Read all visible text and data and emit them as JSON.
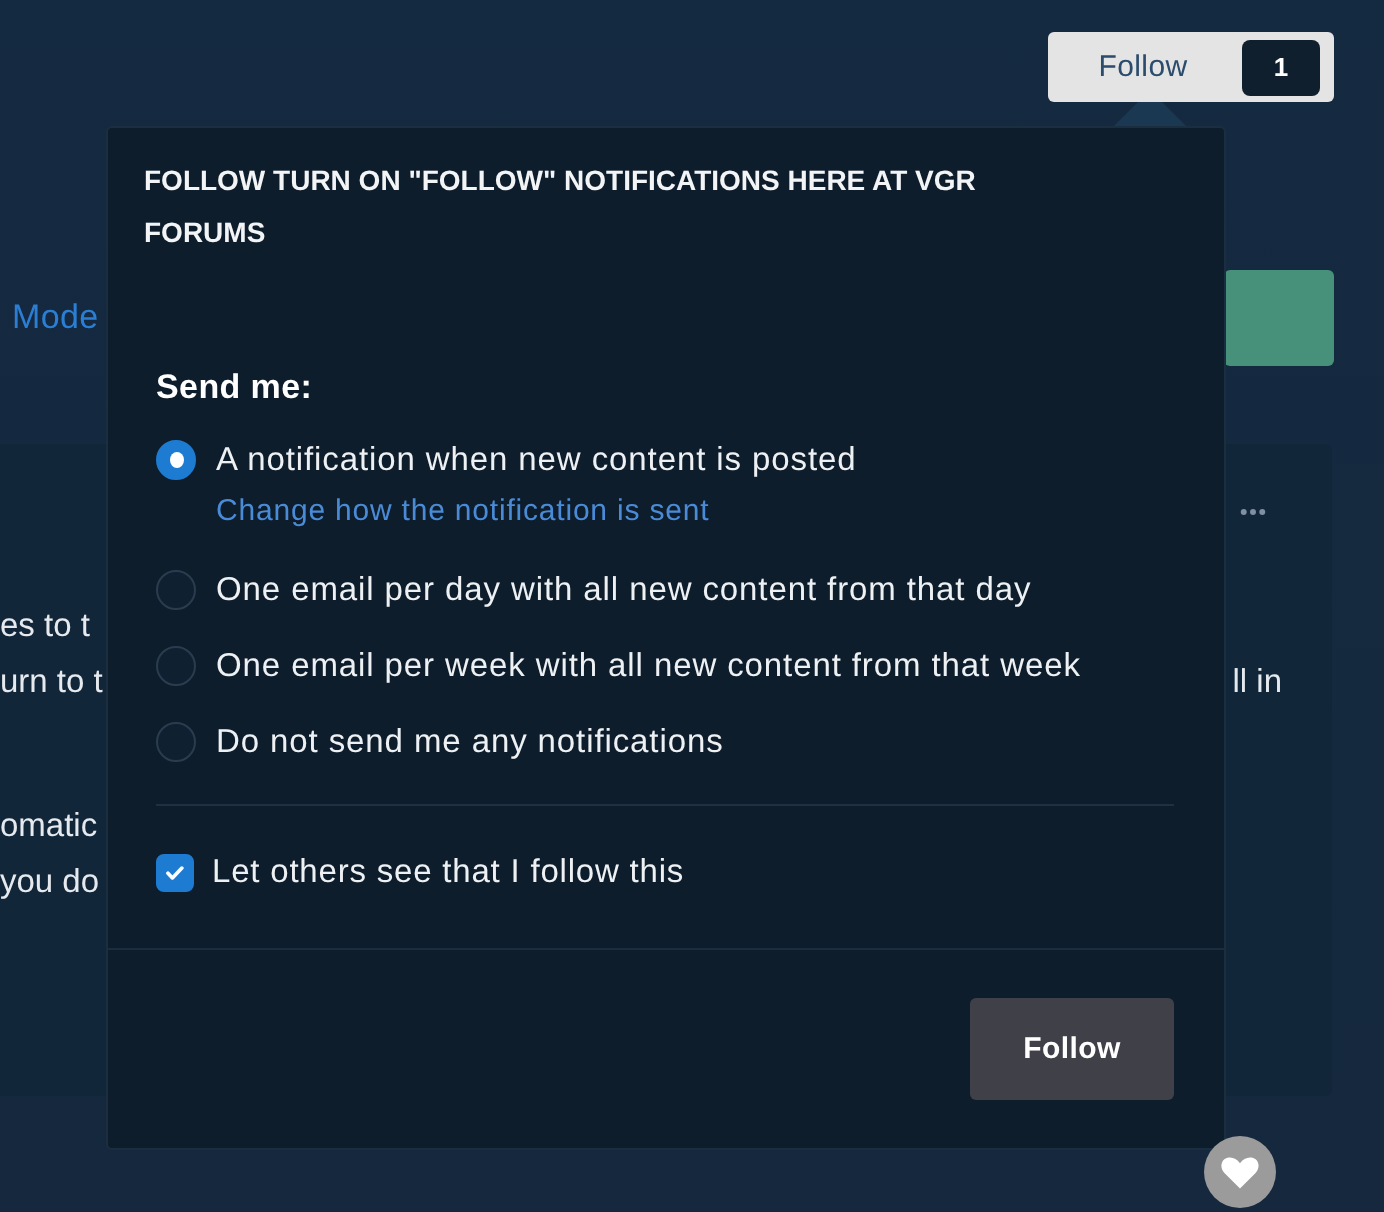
{
  "header": {
    "follow_button": {
      "label": "Follow",
      "count": "1"
    }
  },
  "toolbar": {
    "link": "Mode"
  },
  "card": {
    "paragraphs": [
      {
        "lines": [
          {
            "start": "es to t"
          },
          {
            "start": "urn to t",
            "end": "ll in"
          }
        ]
      },
      {
        "lines": [
          {
            "start": "omatic"
          },
          {
            "start": "you do"
          }
        ]
      }
    ]
  },
  "popup": {
    "title": "FOLLOW TURN ON \"FOLLOW\" NOTIFICATIONS HERE AT VGR FORUMS",
    "section_label": "Send me:",
    "options": [
      {
        "label": "A notification when new content is posted",
        "selected": true,
        "link": "Change how the notification is sent"
      },
      {
        "label": "One email per day with all new content from that day",
        "selected": false
      },
      {
        "label": "One email per week with all new content from that week",
        "selected": false
      },
      {
        "label": "Do not send me any notifications",
        "selected": false
      }
    ],
    "checkbox": {
      "label": "Let others see that I follow this",
      "checked": true
    },
    "submit": "Follow"
  }
}
